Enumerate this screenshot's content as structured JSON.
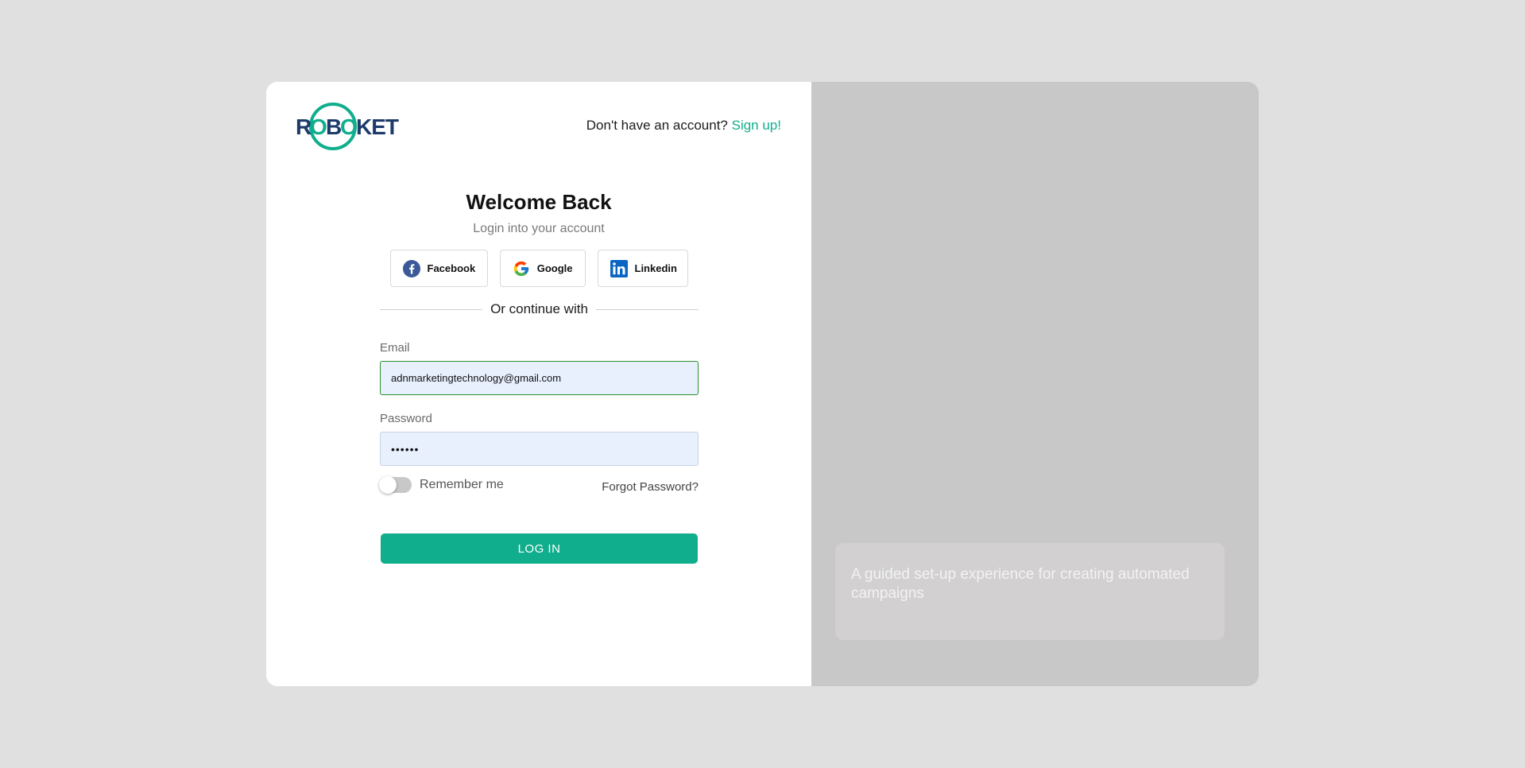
{
  "brand": {
    "logo_text": "ROBOKET",
    "colors": {
      "accent": "#10ae8c",
      "navy": "#1d3a6b",
      "right_panel": "#c8c8c8"
    }
  },
  "header": {
    "signup_prompt": "Don't have an account?",
    "signup_link": "Sign up!"
  },
  "login": {
    "title": "Welcome Back",
    "subtitle": "Login into your account",
    "social": [
      {
        "label": "Facebook",
        "icon": "facebook-icon"
      },
      {
        "label": "Google",
        "icon": "google-icon"
      },
      {
        "label": "Linkedin",
        "icon": "linkedin-icon"
      }
    ],
    "divider_text": "Or continue with",
    "email_label": "Email",
    "email_value": "adnmarketingtechnology@gmail.com",
    "password_label": "Password",
    "password_value": "••••••",
    "remember_label": "Remember me",
    "forgot_label": "Forgot Password?",
    "submit_label": "LOG IN"
  },
  "promo": {
    "text": "A guided set-up experience for creating automated campaigns"
  }
}
